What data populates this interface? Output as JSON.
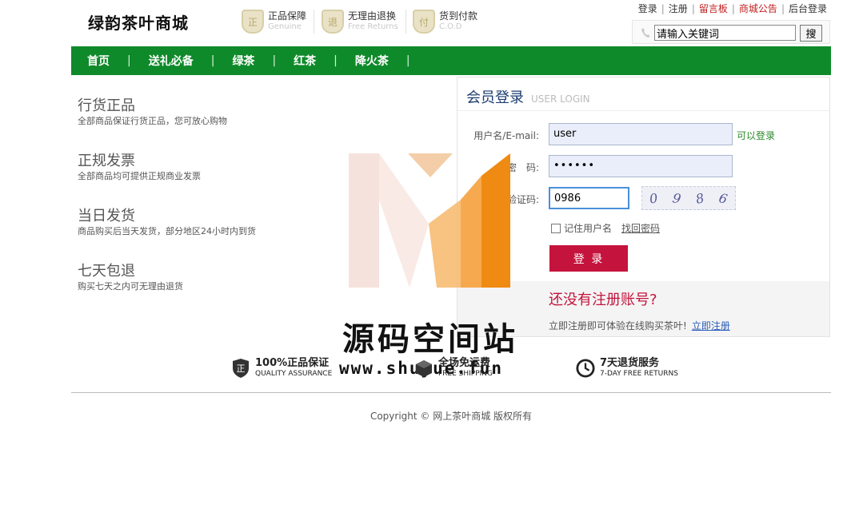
{
  "header": {
    "logo": "绿韵茶叶商城",
    "guarantees": [
      {
        "icon": "genuine-icon",
        "glyph": "正",
        "title": "正品保障",
        "sub": "Genuine"
      },
      {
        "icon": "returns-icon",
        "glyph": "退",
        "title": "无理由退换",
        "sub": "Free Returns"
      },
      {
        "icon": "cod-icon",
        "glyph": "付",
        "title": "货到付款",
        "sub": "C.O.D"
      }
    ],
    "links": [
      "登录",
      "注册",
      "留言板",
      "商城公告",
      "后台登录"
    ],
    "search": {
      "value": "请输入关键词",
      "button": "搜"
    }
  },
  "nav": {
    "items": [
      "首页",
      "送礼必备",
      "绿茶",
      "红茶",
      "降火茶"
    ],
    "separator": "|"
  },
  "features": [
    {
      "title": "行货正品",
      "desc": "全部商品保证行货正品，您可放心购物"
    },
    {
      "title": "正规发票",
      "desc": "全部商品均可提供正规商业发票"
    },
    {
      "title": "当日发货",
      "desc": "商品购买后当天发货，部分地区24小时内到货"
    },
    {
      "title": "七天包退",
      "desc": "购买七天之内可无理由退货"
    }
  ],
  "login": {
    "title": "会员登录",
    "subtitle": "USER LOGIN",
    "username_label": "用户名/E-mail:",
    "username_value": "user",
    "username_hint": "可以登录",
    "password_label": "密　码:",
    "password_value": "••••••",
    "captcha_label": "验证码:",
    "captcha_value": "0986",
    "captcha_chars": [
      "0",
      "9",
      "8",
      "6"
    ],
    "remember_label": "记住用户名",
    "forgot_label": "找回密码",
    "login_button": "登 录",
    "register_title": "还没有注册账号?",
    "register_desc": "立即注册即可体验在线购买茶叶!",
    "register_link": "立即注册"
  },
  "services": [
    {
      "icon": "shield-icon",
      "title": "100%正品保证",
      "sub": "QUALITY ASSURANCE"
    },
    {
      "icon": "box-icon",
      "title": "全场免运费",
      "sub": "FREE SHIPPING"
    },
    {
      "icon": "clock-icon",
      "title": "7天退货服务",
      "sub": "7-DAY FREE RETURNS"
    }
  ],
  "footer": {
    "copyright": "Copyright © 网上茶叶商城 版权所有"
  },
  "watermark": {
    "text": "源码空间站",
    "url": "www.shuyue.fun"
  },
  "colors": {
    "nav": "#0f8a2a",
    "login_button": "#c4133c",
    "register_title": "#c4133c",
    "hint": "#2a8a2a",
    "link": "#2a5bb8"
  }
}
